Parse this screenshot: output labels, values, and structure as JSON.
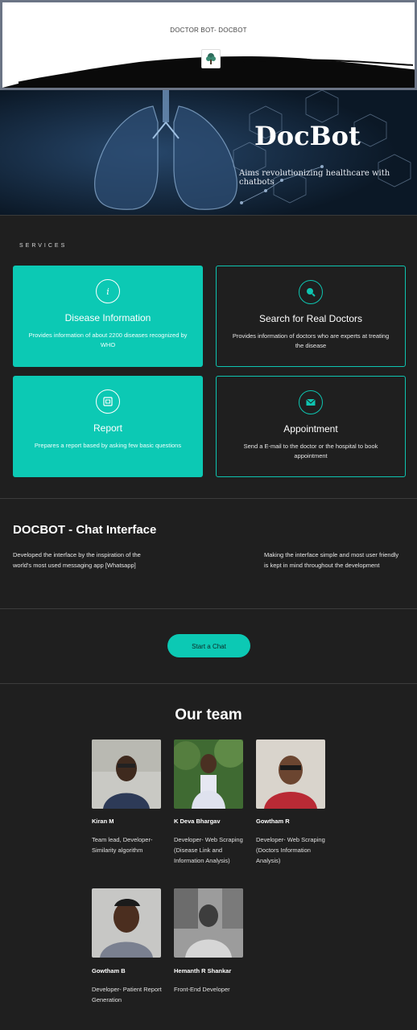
{
  "header": {
    "site_title": "DOCTOR BOT- DOCBOT",
    "logo_icon": "tree-logo-icon"
  },
  "hero": {
    "title": "DocBot",
    "tagline": "Aims revolutionizing healthcare with chatbots"
  },
  "services": {
    "label": "SERVICES",
    "items": [
      {
        "title": "Disease Information",
        "desc": "Provides information of about 2200 diseases recognized by WHO",
        "icon": "info-icon",
        "style": "filled"
      },
      {
        "title": "Search for Real Doctors",
        "desc": "Provides information  of doctors who are experts at treating the disease",
        "icon": "search-icon",
        "style": "outline"
      },
      {
        "title": "Report",
        "desc": "Prepares a report based by asking few basic questions",
        "icon": "report-icon",
        "style": "filled"
      },
      {
        "title": "Appointment",
        "desc": "Send a E-mail to the doctor or the hospital to book appointment",
        "icon": "mail-icon",
        "style": "outline"
      }
    ]
  },
  "chat": {
    "title": "DOCBOT - Chat Interface",
    "left_text": "Developed the interface by the inspiration of the world's most used messaging app [Whatsapp]",
    "right_text": "Making the interface simple and most user friendly is kept in mind throughout the development",
    "button": "Start a Chat"
  },
  "team": {
    "title": "Our  team",
    "members": [
      {
        "name": "Kiran M",
        "role": "Team lead, Developer- Similarity algorithm"
      },
      {
        "name": "K Deva Bhargav",
        "role": " Developer- Web Scraping (Disease Link and Information Analysis)"
      },
      {
        "name": "Gowtham R",
        "role": " Developer- Web Scraping (Doctors Information Analysis)"
      },
      {
        "name": "Gowtham B",
        "role": "Developer- Patient Report Generation"
      },
      {
        "name": "Hemanth R Shankar",
        "role": "Front-End Developer"
      }
    ]
  },
  "colors": {
    "accent": "#0cc9b4",
    "background": "#1f1f1f",
    "hero_bg": "#0c1b2a"
  }
}
